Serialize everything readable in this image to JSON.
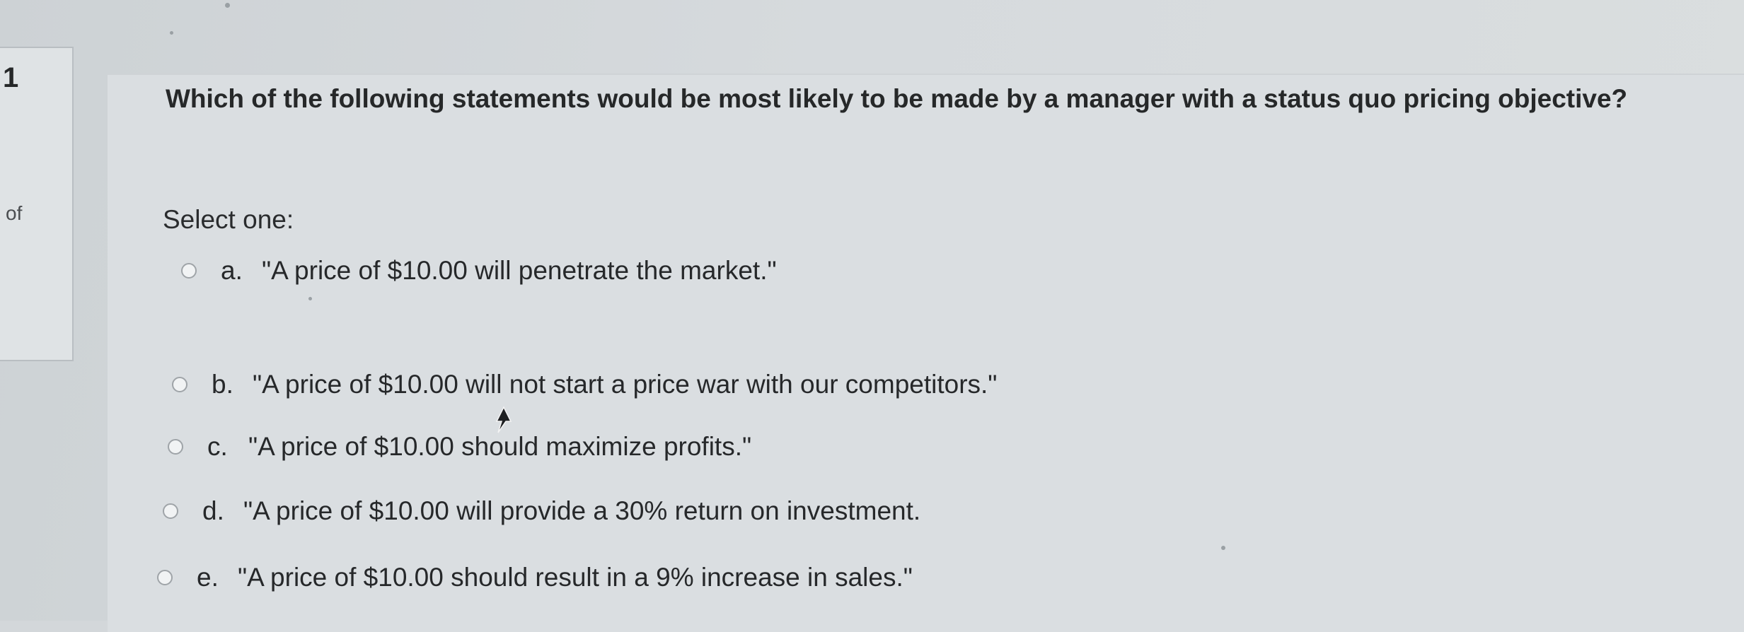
{
  "sidebar": {
    "question_number": "1",
    "of_label": "of"
  },
  "question": {
    "text": "Which of the following statements would be most likely to be made by a manager with a status quo pricing objective?",
    "select_label": "Select one:"
  },
  "options": [
    {
      "letter": "a.",
      "text": "\"A price of $10.00 will penetrate the market.\""
    },
    {
      "letter": "b.",
      "text": "\"A price of $10.00 will not start a price war with our competitors.\""
    },
    {
      "letter": "c.",
      "text": "\"A price of $10.00 should maximize profits.\""
    },
    {
      "letter": "d.",
      "text": "\"A price of $10.00 will provide a 30% return on investment."
    },
    {
      "letter": "e.",
      "text": "\"A price of $10.00 should result in a 9% increase in sales.\""
    }
  ]
}
